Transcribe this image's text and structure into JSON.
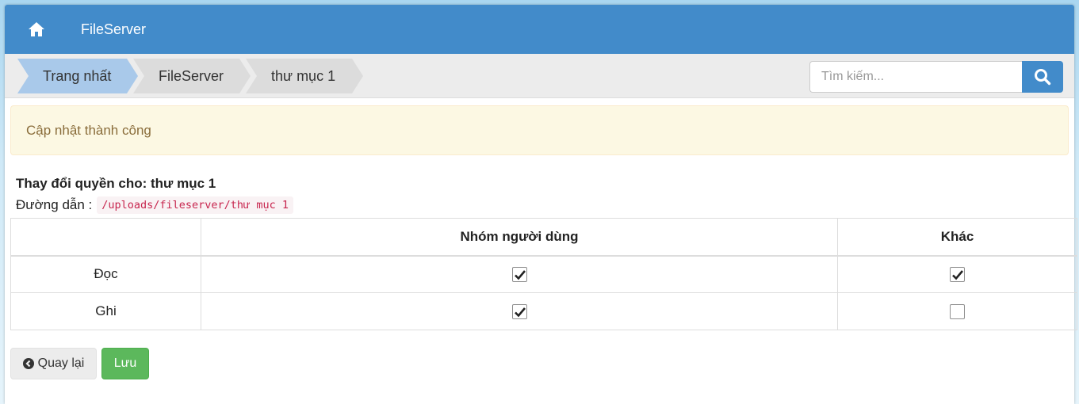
{
  "header": {
    "brand": "FileServer",
    "home_icon": "home-icon"
  },
  "breadcrumb": [
    {
      "label": "Trang nhất",
      "active": true
    },
    {
      "label": "FileServer",
      "active": false
    },
    {
      "label": "thư mục 1",
      "active": false
    }
  ],
  "search": {
    "placeholder": "Tìm kiếm...",
    "value": "",
    "icon": "search-icon"
  },
  "alert": {
    "message": "Cập nhật thành công"
  },
  "permissions": {
    "title": "Thay đổi quyền cho: thư mục 1",
    "path_label": "Đường dẫn :",
    "path_value": "/uploads/fileserver/thư mục 1",
    "columns": [
      "",
      "Nhóm người dùng",
      "Khác"
    ],
    "rows": [
      {
        "label": "Đọc",
        "group": true,
        "other": true
      },
      {
        "label": "Ghi",
        "group": true,
        "other": false
      }
    ]
  },
  "actions": {
    "back_label": "Quay lại",
    "back_icon": "chevron-left-circle-icon",
    "save_label": "Lưu"
  },
  "colors": {
    "primary": "#428bca",
    "alert_bg": "#fcf8e3",
    "alert_text": "#8a6d3b",
    "success": "#5cb85c",
    "crumb_active": "#a9c9ea",
    "crumb_inactive": "#dcdcdc"
  }
}
